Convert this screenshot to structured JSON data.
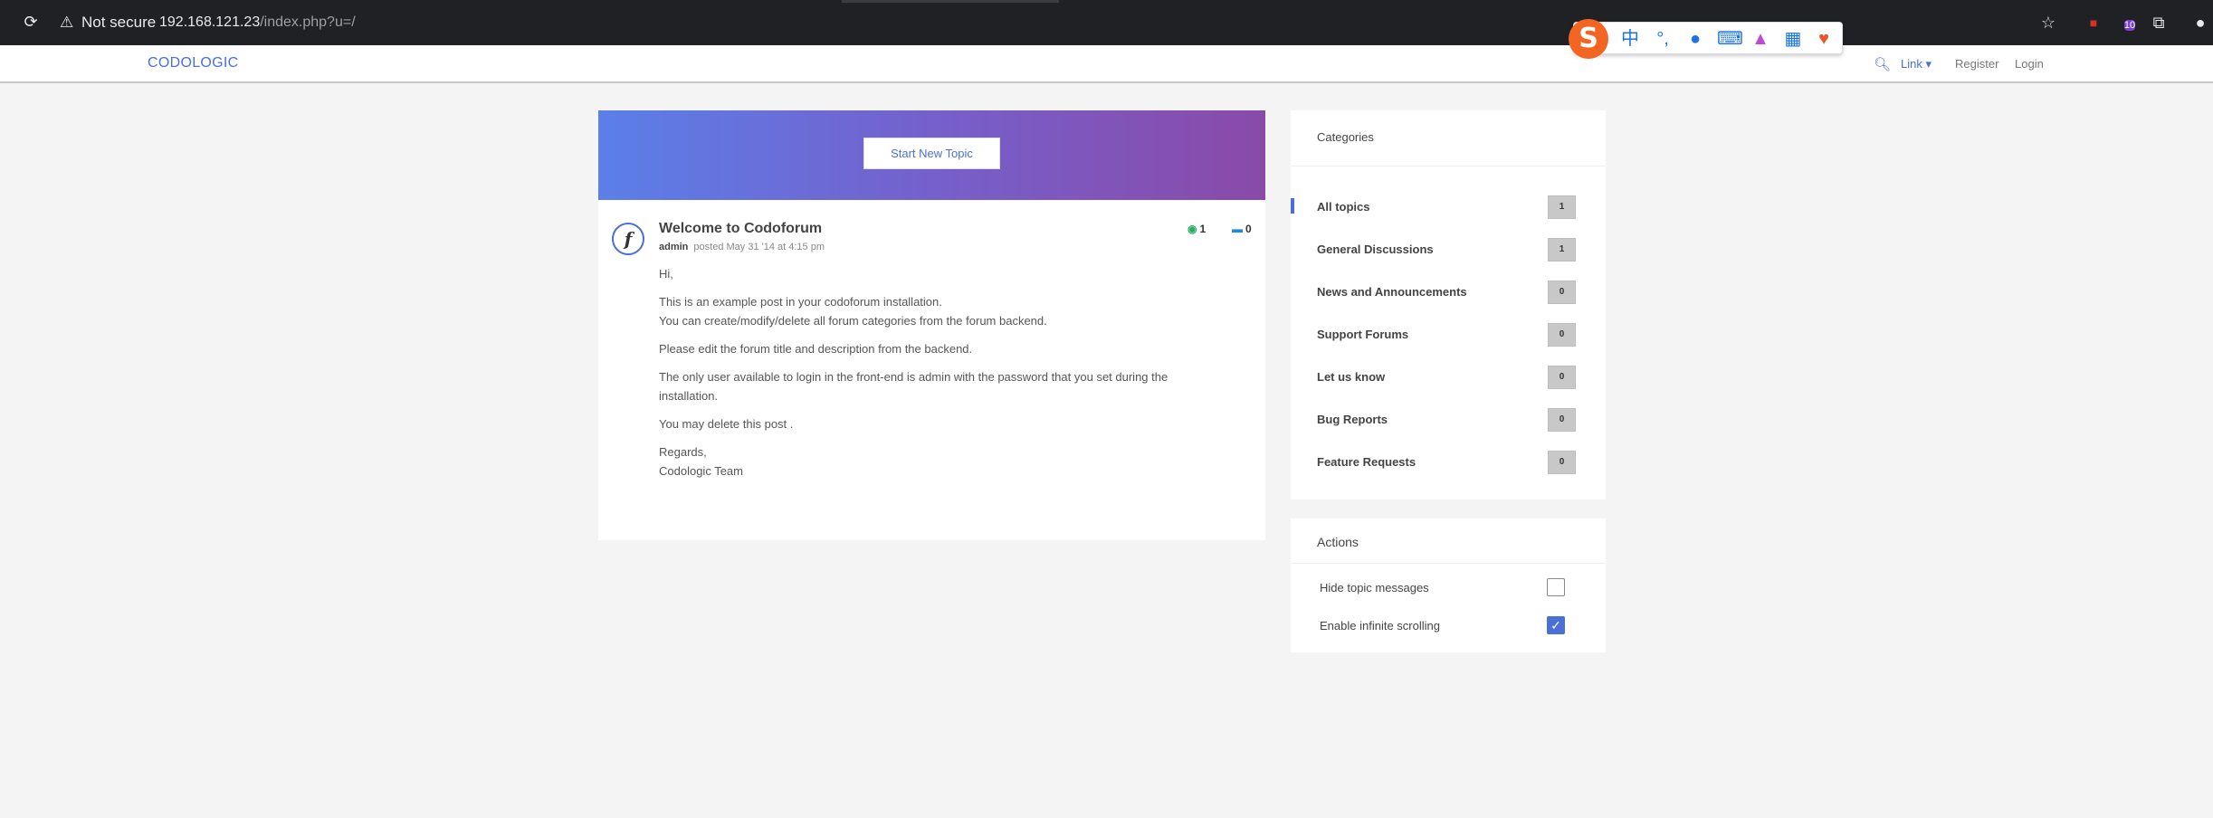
{
  "browser": {
    "security_label": "Not secure",
    "url_host": "192.168.121.23",
    "url_path": "/index.php?u=/",
    "extension_badge": "10"
  },
  "navbar": {
    "brand": "CODOLOGIC",
    "link_label": "Link",
    "register_label": "Register",
    "login_label": "Login"
  },
  "hero": {
    "start_topic_label": "Start New Topic"
  },
  "topic": {
    "title": "Welcome to Codoforum",
    "author": "admin",
    "posted": "posted May 31 '14 at 4:15 pm",
    "views": "1",
    "replies": "0",
    "avatar_letter": "f",
    "body": {
      "greeting": "Hi,",
      "line1": "This is an example post in your codoforum installation.",
      "line2": "You can create/modify/delete all forum categories from the forum backend.",
      "line3": "Please edit the forum title and description from the backend.",
      "line4": "The only user available to login in the front-end is admin with the password that you set during the installation.",
      "line5": "You may delete this post .",
      "regards": "Regards,",
      "signature": "Codologic Team"
    }
  },
  "categories": {
    "heading": "Categories",
    "items": [
      {
        "name": "All topics",
        "count": "1"
      },
      {
        "name": "General Discussions",
        "count": "1"
      },
      {
        "name": "News and Announcements",
        "count": "0"
      },
      {
        "name": "Support Forums",
        "count": "0"
      },
      {
        "name": "Let us know",
        "count": "0"
      },
      {
        "name": "Bug Reports",
        "count": "0"
      },
      {
        "name": "Feature Requests",
        "count": "0"
      }
    ]
  },
  "actions": {
    "heading": "Actions",
    "hide_topic_messages": "Hide topic messages",
    "hide_topic_messages_checked": false,
    "infinite_scrolling": "Enable infinite scrolling",
    "infinite_scrolling_checked": true
  },
  "colors": {
    "accent": "#4a6fd8",
    "hero_start": "#5b7fe8",
    "hero_end": "#8a4aa8"
  }
}
